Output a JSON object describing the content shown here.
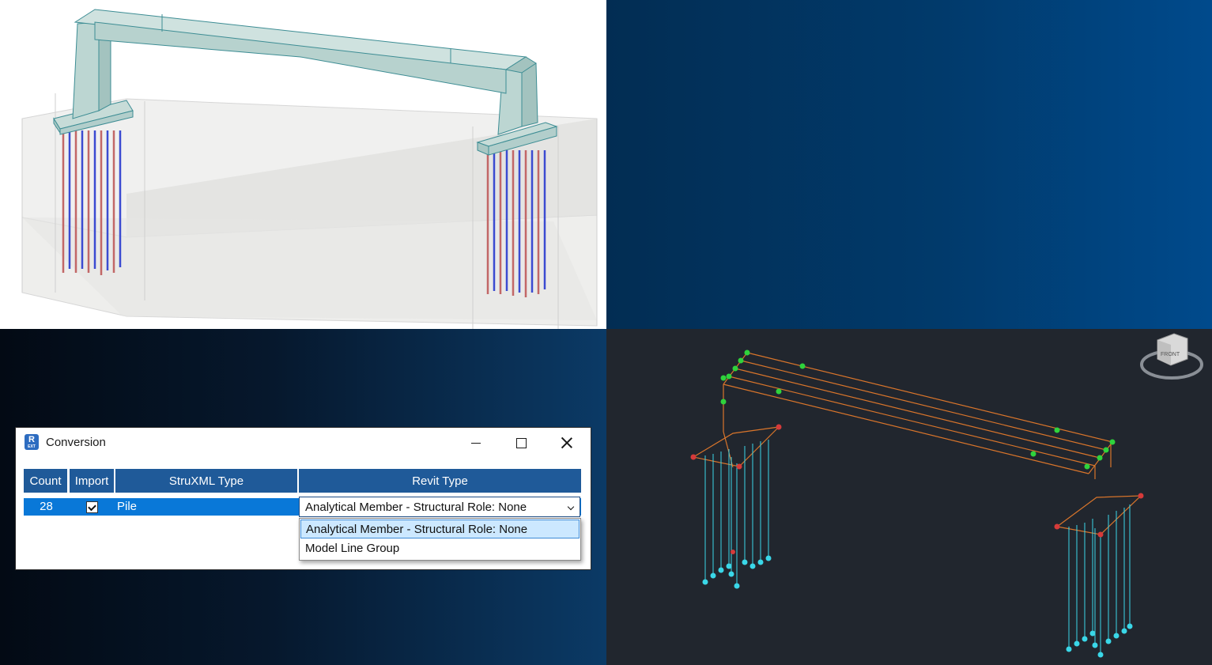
{
  "dialog": {
    "title": "Conversion",
    "app_icon": {
      "letter": "R",
      "sub": "EXT"
    },
    "controls": [
      "minimize-icon",
      "maximize-icon",
      "close-icon"
    ],
    "columns": [
      "Count",
      "Import",
      "StruXML Type",
      "Revit Type"
    ],
    "rows": [
      {
        "count": "28",
        "import": true,
        "struxml_type": "Pile",
        "revit_type": "Analytical Member - Structural Role: None"
      }
    ],
    "dropdown_options": [
      "Analytical Member - Structural Role: None",
      "Model Line Group"
    ]
  },
  "viewcube": {
    "face": "FRONT"
  },
  "colors": {
    "header": "#1f5a99",
    "selection": "#0978d8",
    "option_hover": "#cce8ff",
    "analytical_background": "#21262e",
    "wire": "#d9752b",
    "node_green": "#2fd33c",
    "node_red": "#d63a3a",
    "pile_cyan": "#3ad7e8"
  }
}
